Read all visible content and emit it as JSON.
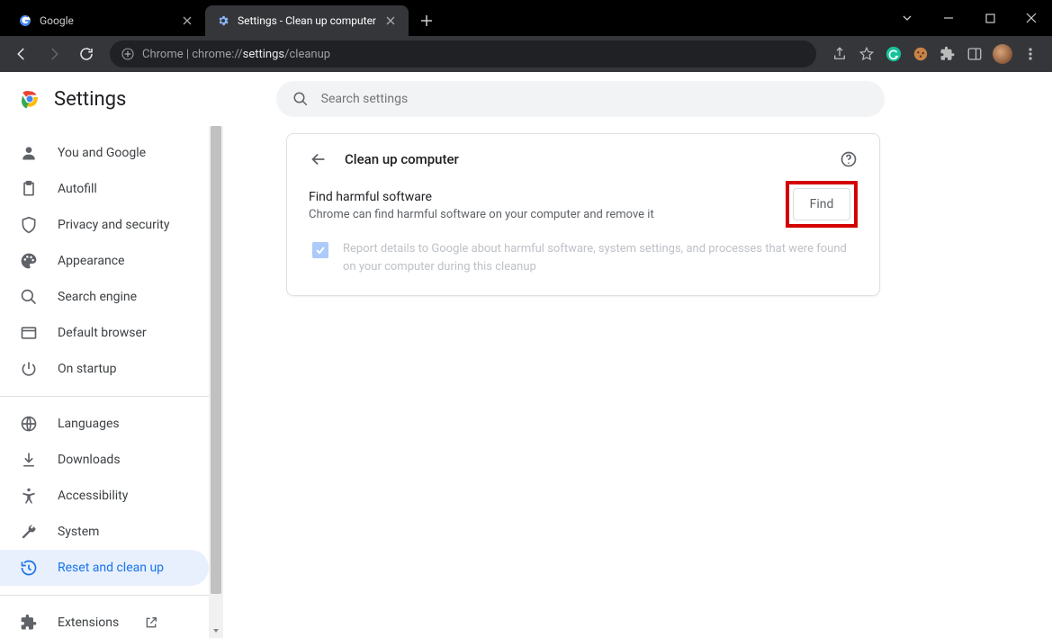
{
  "tabs": [
    {
      "title": "Google"
    },
    {
      "title": "Settings - Clean up computer"
    }
  ],
  "url_prefix": "Chrome",
  "url_scheme": "chrome://",
  "url_bold": "settings",
  "url_tail": "/cleanup",
  "app_title": "Settings",
  "search_placeholder": "Search settings",
  "nav": {
    "you": "You and Google",
    "autofill": "Autofill",
    "privacy": "Privacy and security",
    "appearance": "Appearance",
    "search_engine": "Search engine",
    "default_browser": "Default browser",
    "startup": "On startup",
    "languages": "Languages",
    "downloads": "Downloads",
    "accessibility": "Accessibility",
    "system": "System",
    "reset": "Reset and clean up",
    "extensions": "Extensions"
  },
  "page": {
    "title": "Clean up computer",
    "section_title": "Find harmful software",
    "section_sub": "Chrome can find harmful software on your computer and remove it",
    "find_label": "Find",
    "report_text": "Report details to Google about harmful software, system settings, and processes that were found on your computer during this cleanup"
  }
}
